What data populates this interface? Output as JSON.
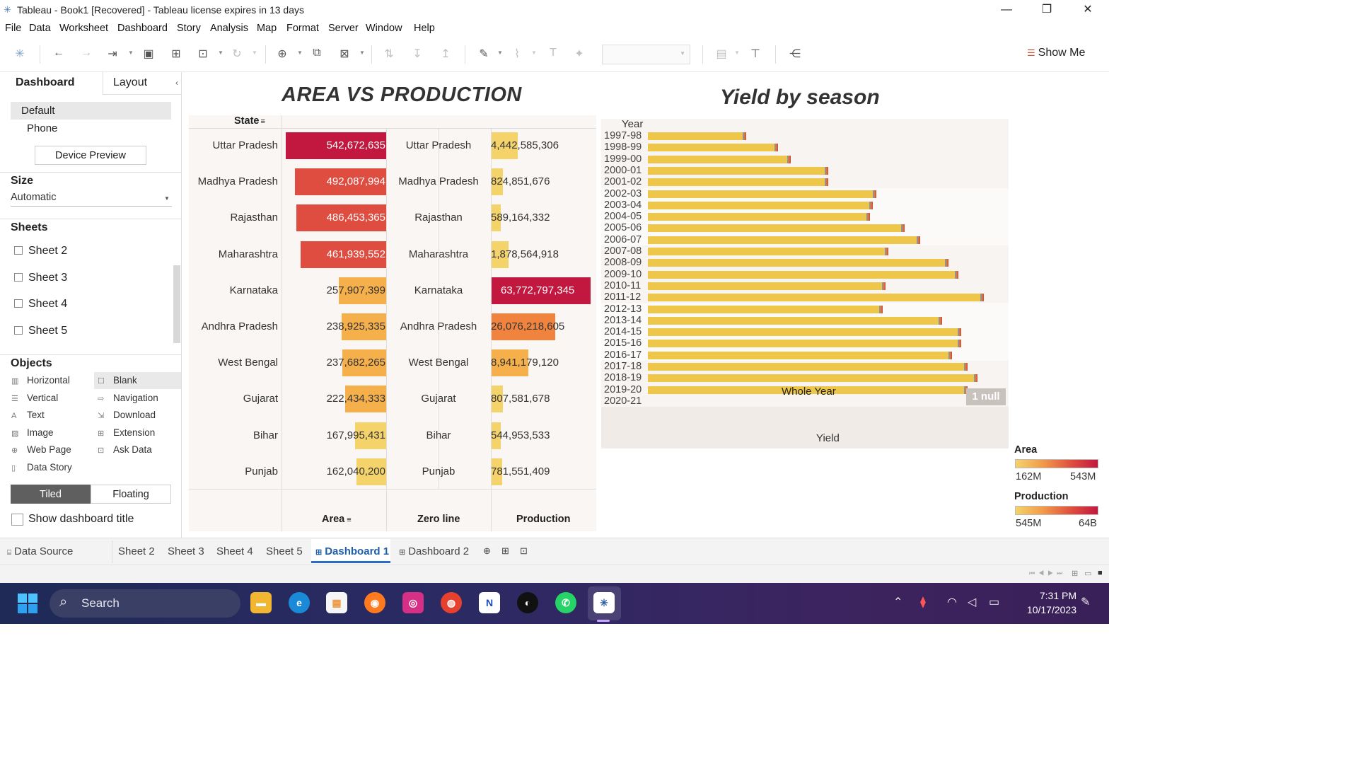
{
  "window": {
    "title": "Tableau - Book1 [Recovered] - Tableau license expires in 13 days",
    "min": "—",
    "max": "❐",
    "close": "✕"
  },
  "menu": [
    "File",
    "Data",
    "Worksheet",
    "Dashboard",
    "Story",
    "Analysis",
    "Map",
    "Format",
    "Server",
    "Window",
    "Help"
  ],
  "toolbar": {
    "show_me": "Show Me"
  },
  "left_panel": {
    "tab_dashboard": "Dashboard",
    "tab_layout": "Layout",
    "device_default": "Default",
    "device_phone": "Phone",
    "device_preview": "Device Preview",
    "size_head": "Size",
    "size_value": "Automatic",
    "sheets_head": "Sheets",
    "sheets": [
      "Sheet 2",
      "Sheet 3",
      "Sheet 4",
      "Sheet 5"
    ],
    "objects_head": "Objects",
    "objects_left": [
      "Horizontal",
      "Vertical",
      "Text",
      "Image",
      "Web Page",
      "Data Story"
    ],
    "objects_right": [
      "Blank",
      "Navigation",
      "Download",
      "Extension",
      "Ask Data"
    ],
    "tiled": "Tiled",
    "floating": "Floating",
    "show_title": "Show dashboard title"
  },
  "dashboard": {
    "title_left": "AREA VS PRODUCTION",
    "title_right": "Yield by season",
    "col_state": "State",
    "col_area": "Area",
    "col_zero": "Zero line",
    "col_production": "Production",
    "rows": [
      {
        "state": "Uttar Pradesh",
        "area": "542,672,635",
        "production": "4,442,585,306"
      },
      {
        "state": "Madhya Pradesh",
        "area": "492,087,994",
        "production": "824,851,676"
      },
      {
        "state": "Rajasthan",
        "area": "486,453,365",
        "production": "589,164,332"
      },
      {
        "state": "Maharashtra",
        "area": "461,939,552",
        "production": "1,878,564,918"
      },
      {
        "state": "Karnataka",
        "area": "257,907,399",
        "production": "63,772,797,345"
      },
      {
        "state": "Andhra Pradesh",
        "area": "238,925,335",
        "production": "26,076,218,605"
      },
      {
        "state": "West Bengal",
        "area": "237,682,265",
        "production": "8,941,179,120"
      },
      {
        "state": "Gujarat",
        "area": "222,434,333",
        "production": "807,581,678"
      },
      {
        "state": "Bihar",
        "area": "167,995,431",
        "production": "544,953,533"
      },
      {
        "state": "Punjab",
        "area": "162,040,200",
        "production": "781,551,409"
      }
    ],
    "yield": {
      "header": "Year",
      "axis_label": "Yield",
      "bar_label": "Whole Year",
      "null_badge": "1 null",
      "years": [
        "1997-98",
        "1998-99",
        "1999-00",
        "2000-01",
        "2001-02",
        "2002-03",
        "2003-04",
        "2004-05",
        "2005-06",
        "2006-07",
        "2007-08",
        "2008-09",
        "2009-10",
        "2010-11",
        "2011-12",
        "2012-13",
        "2013-14",
        "2014-15",
        "2015-16",
        "2016-17",
        "2017-18",
        "2018-19",
        "2019-20",
        "2020-21"
      ]
    },
    "legend_area": {
      "title": "Area",
      "min": "162M",
      "max": "543M"
    },
    "legend_production": {
      "title": "Production",
      "min": "545M",
      "max": "64B"
    }
  },
  "chart_data": [
    {
      "type": "table",
      "title": "AREA VS PRODUCTION",
      "columns": [
        "State",
        "Area",
        "Production"
      ],
      "categories": [
        "Uttar Pradesh",
        "Madhya Pradesh",
        "Rajasthan",
        "Maharashtra",
        "Karnataka",
        "Andhra Pradesh",
        "West Bengal",
        "Gujarat",
        "Bihar",
        "Punjab"
      ],
      "series": [
        {
          "name": "Area",
          "values": [
            542672635,
            492087994,
            486453365,
            461939552,
            257907399,
            238925335,
            237682265,
            222434333,
            167995431,
            162040200
          ]
        },
        {
          "name": "Production",
          "values": [
            4442585306,
            824851676,
            589164332,
            1878564918,
            63772797345,
            26076218605,
            8941179120,
            807581678,
            544953533,
            781551409
          ]
        }
      ]
    },
    {
      "type": "bar",
      "title": "Yield by season",
      "ylabel": "Year",
      "xlabel": "Yield",
      "categories": [
        "1997-98",
        "1998-99",
        "1999-00",
        "2000-01",
        "2001-02",
        "2002-03",
        "2003-04",
        "2004-05",
        "2005-06",
        "2006-07",
        "2007-08",
        "2008-09",
        "2009-10",
        "2010-11",
        "2011-12",
        "2012-13",
        "2013-14",
        "2014-15",
        "2015-16",
        "2016-17",
        "2017-18",
        "2018-19",
        "2019-20",
        "2020-21"
      ],
      "values": [
        0.3,
        0.4,
        0.44,
        0.56,
        0.56,
        0.71,
        0.7,
        0.69,
        0.8,
        0.85,
        0.75,
        0.94,
        0.97,
        0.74,
        1.05,
        0.73,
        0.92,
        0.98,
        0.98,
        0.95,
        1.0,
        1.03,
        1.0,
        0
      ],
      "ylim": [
        0,
        1.1
      ]
    }
  ],
  "sheet_tabs": [
    "Data Source",
    "Sheet 2",
    "Sheet 3",
    "Sheet 4",
    "Sheet 5",
    "Dashboard 1",
    "Dashboard 2"
  ],
  "taskbar": {
    "search": "Search",
    "time": "7:31 PM",
    "date": "10/17/2023"
  }
}
